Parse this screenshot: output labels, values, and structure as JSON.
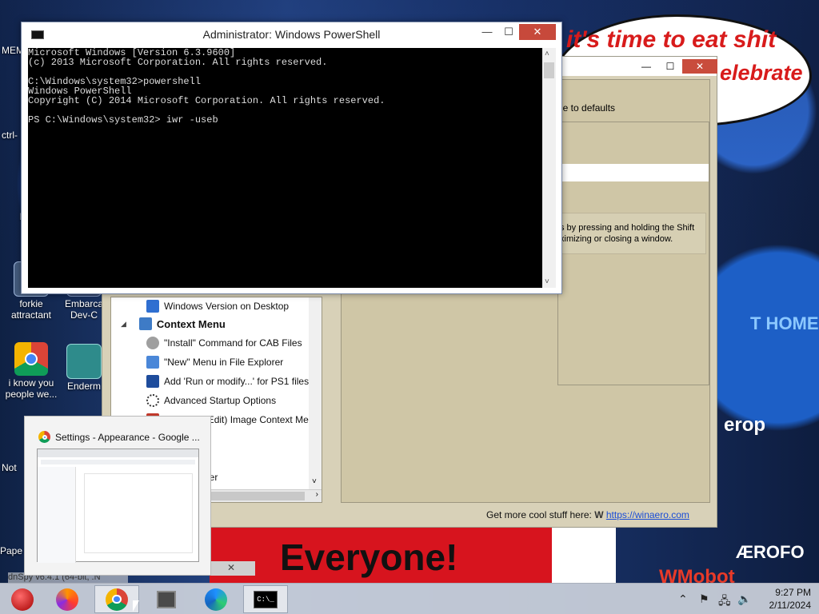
{
  "desktop": {
    "speech_line1": "it's time to eat shit",
    "speech_line2": "elebrate",
    "poster_text": "Everyone!",
    "wmobot_text": "WMobot",
    "right_texts": [
      "T HOME",
      "erop",
      "ÆROFO"
    ],
    "partial_labels": [
      "MEM",
      "ctrl-",
      "F",
      "Not",
      "Pape"
    ],
    "icons": [
      {
        "label": "forkie attractant"
      },
      {
        "label": "Embarca Dev-C"
      },
      {
        "label": "i know you people we..."
      },
      {
        "label": "Enderm"
      }
    ]
  },
  "winaero": {
    "restore_label": "ge to defaults",
    "desc_line1": "s by pressing and holding the Shift",
    "desc_line2": "ximizing or closing a window.",
    "tree": [
      {
        "label": "Windows Version on Desktop",
        "indent": false
      },
      {
        "label": "Context Menu",
        "bold": true
      },
      {
        "label": "\"Install\" Command for CAB Files"
      },
      {
        "label": "\"New\" Menu in File Explorer"
      },
      {
        "label": "Add 'Run or modify...' for PS1 files"
      },
      {
        "label": "Advanced Startup Options"
      },
      {
        "label": "Apply for (Edit) Image Context Menu"
      },
      {
        "label": "ner"
      }
    ],
    "footer_text": "Get more cool stuff here: ",
    "footer_link": "https://winaero.com"
  },
  "powershell": {
    "title": "Administrator: Windows PowerShell",
    "lines": [
      "Microsoft Windows [Version 6.3.9600]",
      "(c) 2013 Microsoft Corporation. All rights reserved.",
      "",
      "C:\\Windows\\system32>powershell",
      "Windows PowerShell",
      "Copyright (C) 2014 Microsoft Corporation. All rights reserved.",
      "",
      "PS C:\\Windows\\system32> iwr -useb"
    ]
  },
  "preview": {
    "title": "Settings - Appearance - Google ..."
  },
  "taskbar_items": [
    "Firefox",
    "Google Chrome",
    "Task View",
    "Edge",
    "PowerShell"
  ],
  "clock": {
    "time": "9:27 PM",
    "date": "2/11/2024"
  },
  "partial_taskbar_label": "dnSpy v6.4.1 (64-bit, .N"
}
